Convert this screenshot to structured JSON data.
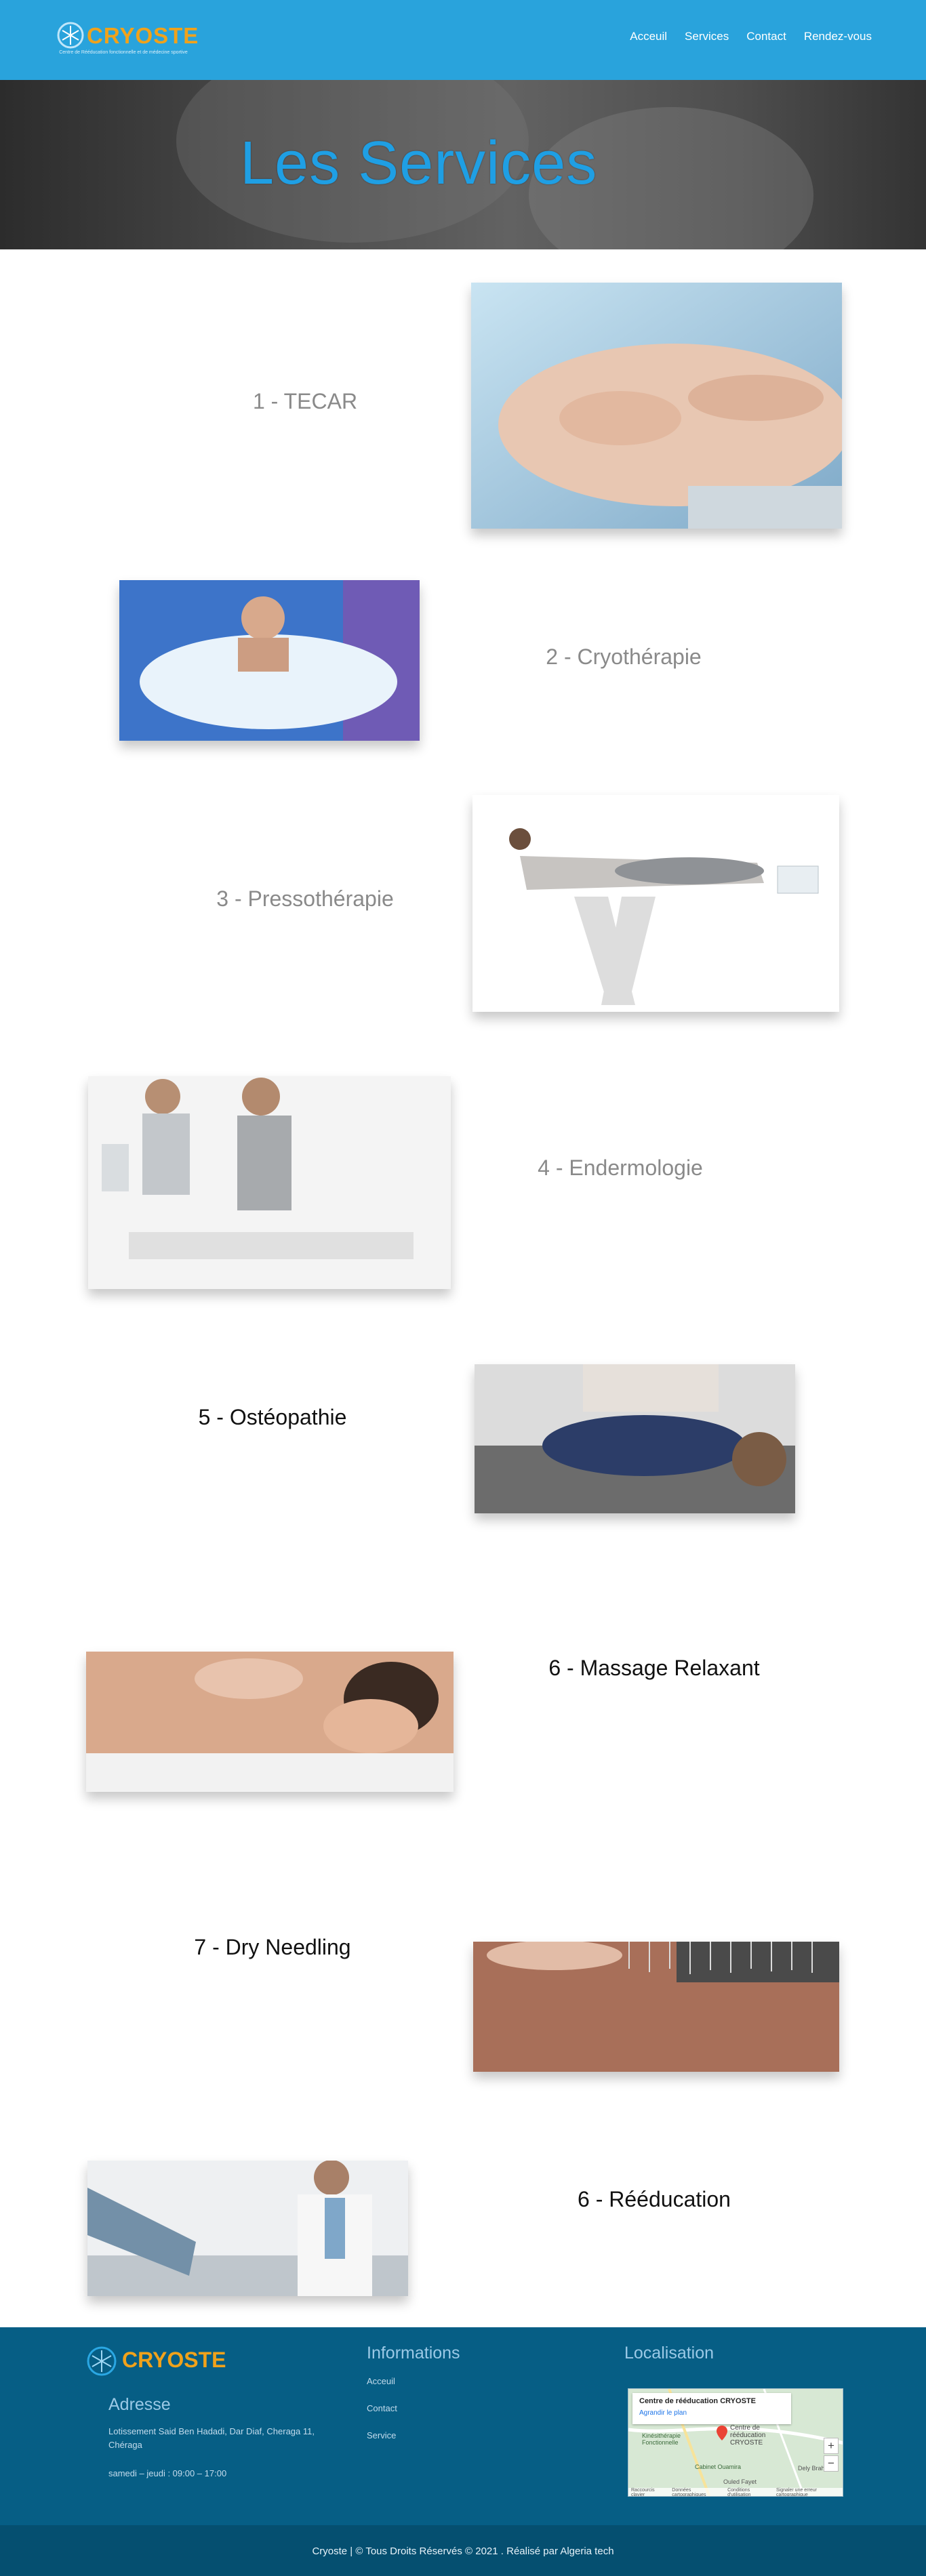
{
  "header": {
    "logo_text": "CRYOSTE",
    "logo_tagline": "Centre de Rééducation fonctionnelle et de médecine sportive",
    "nav": [
      "Acceuil",
      "Services",
      "Contact",
      "Rendez-vous"
    ]
  },
  "hero": {
    "title": "Les Services"
  },
  "services": [
    {
      "title": "1 - TECAR"
    },
    {
      "title": "2 - Cryothérapie"
    },
    {
      "title": "3 - Pressothérapie"
    },
    {
      "title": "4 - Endermologie"
    },
    {
      "title": "5 - Ostéopathie"
    },
    {
      "title": "6 - Massage Relaxant"
    },
    {
      "title": "7 - Dry Needling"
    },
    {
      "title": "6 - Rééducation"
    }
  ],
  "footer": {
    "logo_text": "CRYOSTE",
    "address_heading": "Adresse",
    "address": "Lotissement Said Ben Hadadi, Dar Diaf, Cheraga 11, Chéraga",
    "hours": "samedi – jeudi : 09:00 – 17:00",
    "info_heading": "Informations",
    "links": [
      "Acceuil",
      "Contact",
      "Service"
    ],
    "location_heading": "Localisation",
    "map": {
      "place_name": "Centre de rééducation CRYOSTE",
      "place_link": "Agrandir le plan",
      "pin_label": "Centre de rééducation CRYOSTE",
      "labels": [
        "Kinésithérapie Fonctionnelle",
        "Cabinet Ouamira",
        "Dely Brahim",
        "Ouled Fayet"
      ],
      "footer_items": [
        "Raccourcis clavier",
        "Données cartographiques",
        "Conditions d'utilisation",
        "Signaler une erreur cartographique"
      ]
    },
    "copyright": "Cryoste | © Tous Droits Réservés © 2021 . Réalisé par Algeria tech"
  },
  "colors": {
    "header": "#29a3dc",
    "accent": "#f0a21b",
    "hero_text": "#1f9fe4",
    "footer": "#065e85",
    "bottom_bar": "#054f70"
  }
}
